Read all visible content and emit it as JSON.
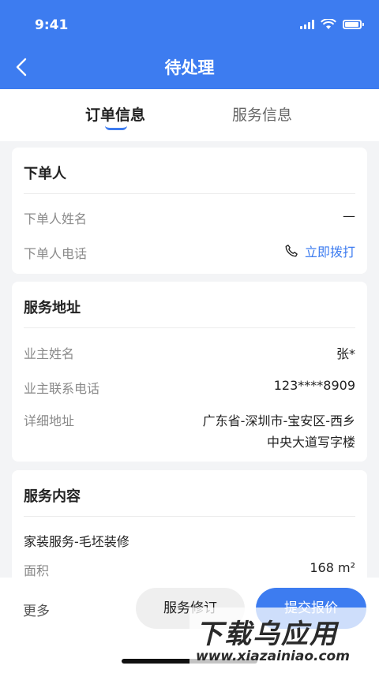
{
  "status_bar": {
    "time": "9:41"
  },
  "header": {
    "title": "待处理"
  },
  "tabs": [
    {
      "label": "订单信息",
      "active": true
    },
    {
      "label": "服务信息",
      "active": false
    }
  ],
  "orderer": {
    "title": "下单人",
    "name_label": "下单人姓名",
    "name_value": "—",
    "phone_label": "下单人电话",
    "call_label": "立即拨打"
  },
  "address": {
    "title": "服务地址",
    "owner_label": "业主姓名",
    "owner_value": "张*",
    "phone_label": "业主联系电话",
    "phone_value": "123****8909",
    "detail_label": "详细地址",
    "detail_line1": "广东省-深圳市-宝安区-西乡",
    "detail_line2": "中央大道写字楼"
  },
  "content": {
    "title": "服务内容",
    "service_name": "家装服务-毛坯装修",
    "area_label": "面积",
    "area_value": "168 m²"
  },
  "bottom": {
    "more": "更多",
    "revise": "服务修订",
    "submit": "提交报价"
  },
  "watermark": {
    "logo": "下载乌应用",
    "url": "www.xiazainiao.com"
  },
  "colors": {
    "accent": "#3d7cf0"
  }
}
